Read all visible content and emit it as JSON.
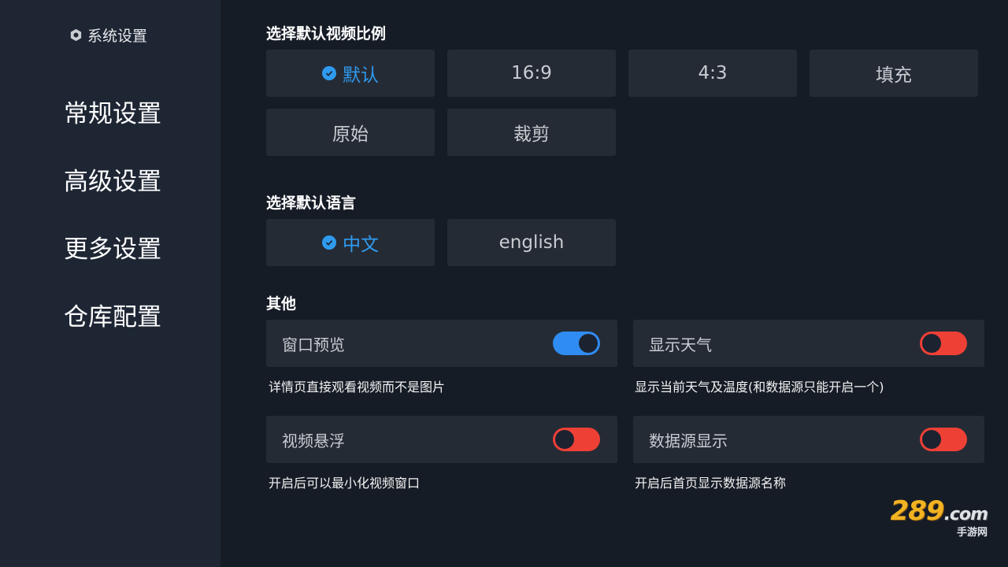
{
  "sidebar": {
    "title": "系统设置",
    "items": [
      {
        "label": "常规设置"
      },
      {
        "label": "高级设置"
      },
      {
        "label": "更多设置"
      },
      {
        "label": "仓库配置"
      }
    ]
  },
  "aspect": {
    "title": "选择默认视频比例",
    "options": [
      {
        "label": "默认",
        "selected": true
      },
      {
        "label": "16:9"
      },
      {
        "label": "4:3"
      },
      {
        "label": "填充"
      },
      {
        "label": "原始"
      },
      {
        "label": "裁剪"
      }
    ]
  },
  "language": {
    "title": "选择默认语言",
    "options": [
      {
        "label": "中文",
        "selected": true
      },
      {
        "label": "english"
      }
    ]
  },
  "other": {
    "title": "其他",
    "toggles": [
      {
        "label": "窗口预览",
        "state": "on",
        "desc": "详情页直接观看视频而不是图片"
      },
      {
        "label": "显示天气",
        "state": "off",
        "desc": "显示当前天气及温度(和数据源只能开启一个)"
      },
      {
        "label": "视频悬浮",
        "state": "off",
        "desc": "开启后可以最小化视频窗口"
      },
      {
        "label": "数据源显示",
        "state": "off",
        "desc": "开启后首页显示数据源名称"
      }
    ]
  },
  "watermark": {
    "main": "289",
    "com": ".com",
    "sub": "手游网"
  },
  "colors": {
    "accent": "#2f9bf0",
    "toggle_on": "#2f8cf2",
    "toggle_off": "#ef4036"
  }
}
